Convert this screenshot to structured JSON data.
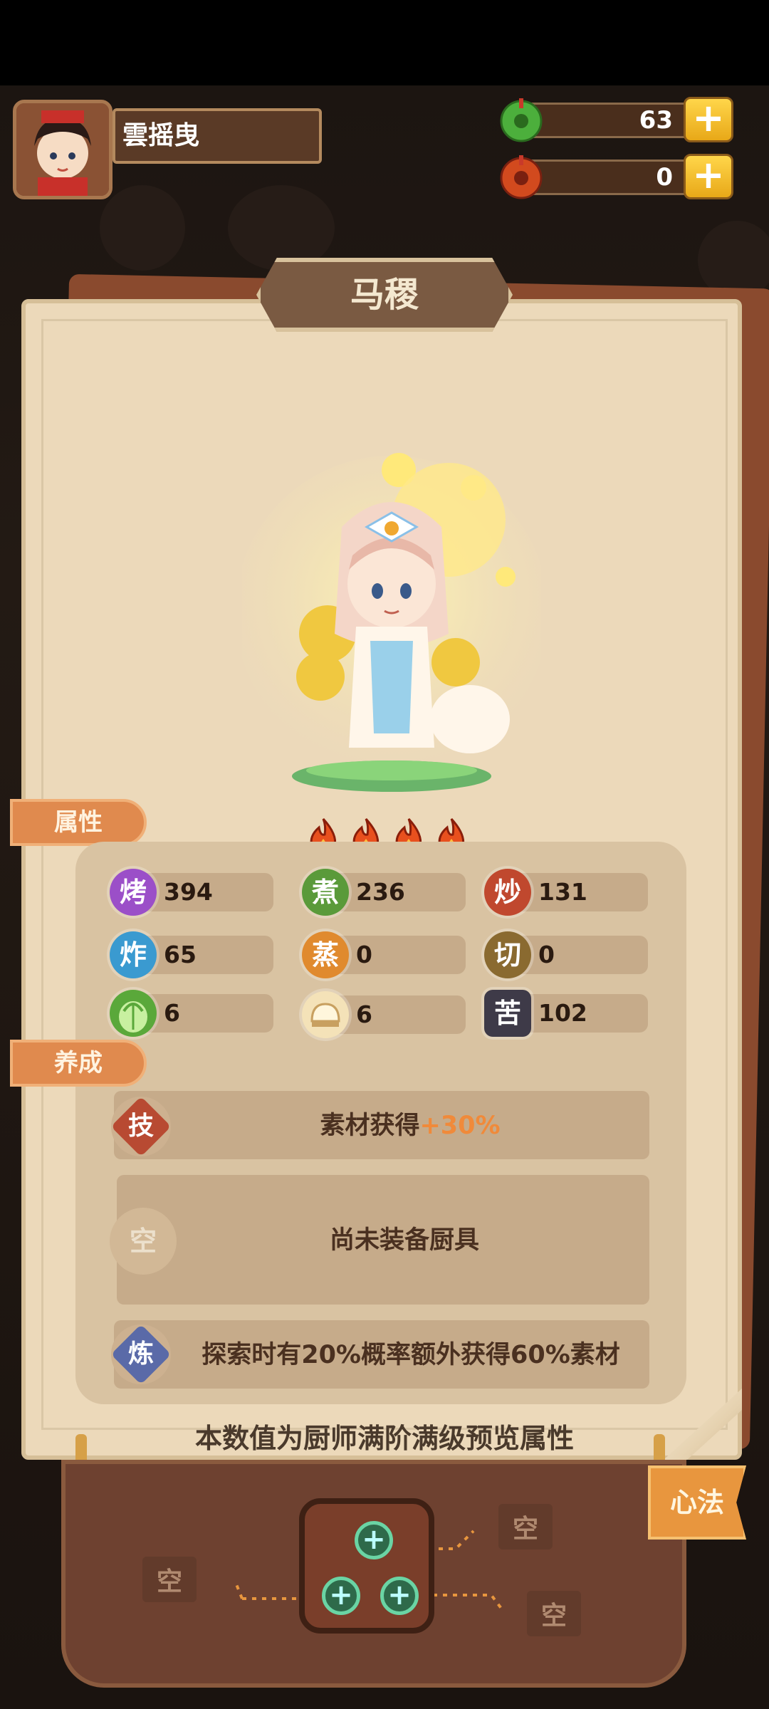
{
  "player": {
    "name": "雲摇曳"
  },
  "currencies": [
    {
      "icon": "green-jade-icon",
      "value": "63",
      "color": "#4caf3c"
    },
    {
      "icon": "red-jade-icon",
      "value": "0",
      "color": "#d24a1e"
    }
  ],
  "chef": {
    "name": "马稷",
    "star_count": 4
  },
  "sections": {
    "attributes": "属性",
    "cultivation": "养成"
  },
  "stats": [
    {
      "icon_text": "烤",
      "value": "394",
      "color": "#9b4fc8"
    },
    {
      "icon_text": "煮",
      "value": "236",
      "color": "#5a9a3a"
    },
    {
      "icon_text": "炒",
      "value": "131",
      "color": "#c0482e"
    },
    {
      "icon_text": "炸",
      "value": "65",
      "color": "#3a9ad0"
    },
    {
      "icon_text": "蒸",
      "value": "0",
      "color": "#e08a2e"
    },
    {
      "icon_text": "切",
      "value": "0",
      "color": "#8a6a30"
    },
    {
      "icon_text": "",
      "value": "6",
      "color": "#6ac04a"
    },
    {
      "icon_text": "",
      "value": "6",
      "color": "#e9c88a"
    },
    {
      "icon_text": "苦",
      "value": "102",
      "color": "#3e3a48"
    }
  ],
  "skill": {
    "badge": "技",
    "text": "素材获得",
    "bonus": "+30%"
  },
  "equipment": {
    "badge": "空",
    "text": "尚未装备厨具"
  },
  "refine": {
    "badge": "炼",
    "text": "探索时有20%概率额外获得60%素材"
  },
  "footer_note": "本数值为厨师满阶满级预览属性",
  "bottom": {
    "empty_left": "空",
    "empty_top_right": "空",
    "empty_bottom_right": "空",
    "xinfa_button": "心法"
  }
}
